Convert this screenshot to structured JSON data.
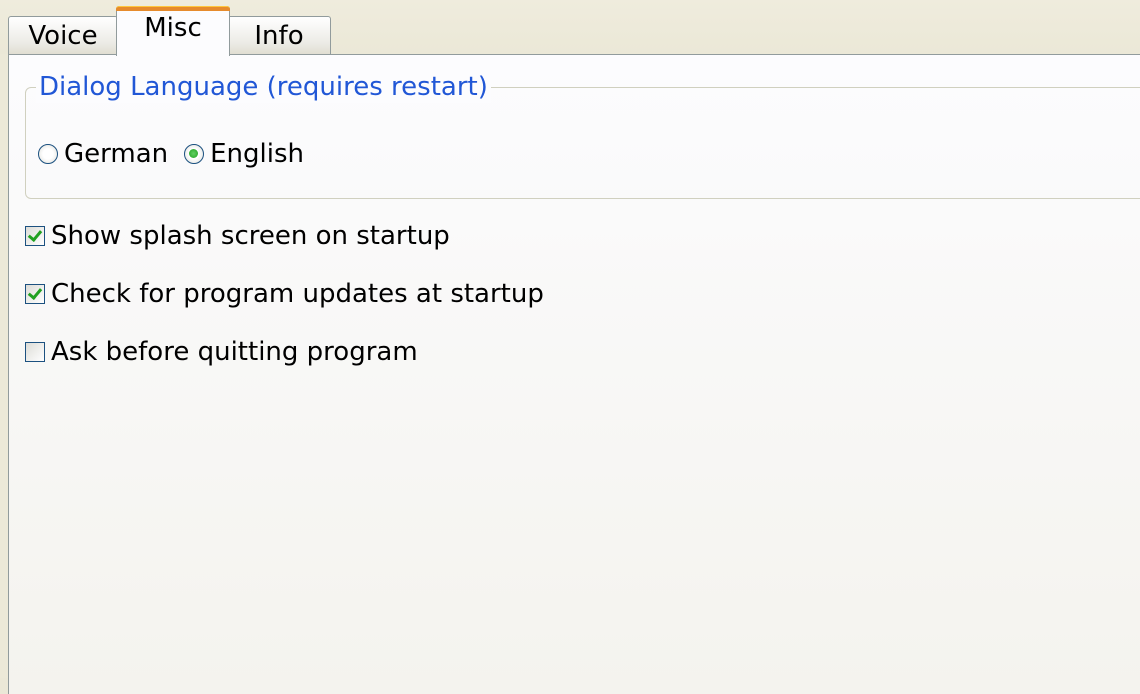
{
  "tabs": [
    {
      "label": "Voice",
      "active": false
    },
    {
      "label": "Misc",
      "active": true
    },
    {
      "label": "Info",
      "active": false
    }
  ],
  "dialog_language": {
    "title": "Dialog Language (requires restart)",
    "options": [
      {
        "label": "German",
        "selected": false
      },
      {
        "label": "English",
        "selected": true
      }
    ]
  },
  "options": [
    {
      "label": "Show splash screen on startup",
      "checked": true
    },
    {
      "label": "Check for program updates at startup",
      "checked": true
    },
    {
      "label": "Ask before quitting program",
      "checked": false
    }
  ],
  "colors": {
    "accent_blue": "#2157d6",
    "check_green": "#21a121",
    "tab_active_orange": "#e68b2c"
  }
}
